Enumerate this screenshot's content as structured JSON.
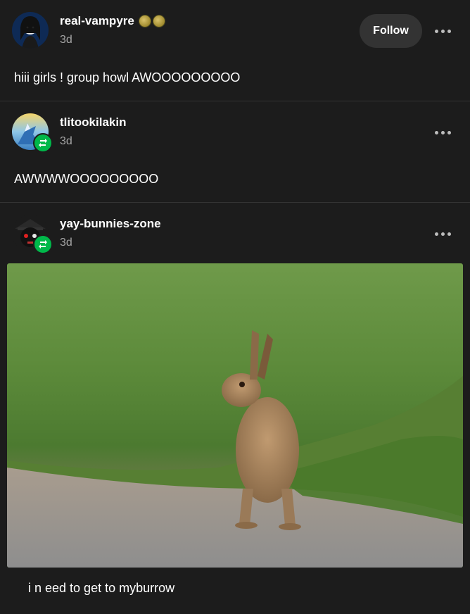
{
  "posts": [
    {
      "username": "real-vampyre",
      "time": "3d",
      "text": "hiii girls ! group howl AWOOOOOOOOO",
      "follow_label": "Follow",
      "badges": [
        "moon-badge",
        "moon-badge"
      ]
    },
    {
      "username": "tlitookilakin",
      "time": "3d",
      "text": "AWWWWOOOOOOOOO"
    },
    {
      "username": "yay-bunnies-zone",
      "time": "3d",
      "image_alt": "hare sitting at grassy roadside",
      "text": "i n eed to get to myburrow"
    }
  ],
  "colors": {
    "background": "#1c1c1c",
    "follow_button": "#333333",
    "reblog_badge": "#00b84a",
    "muted_text": "#a5a5a5"
  }
}
